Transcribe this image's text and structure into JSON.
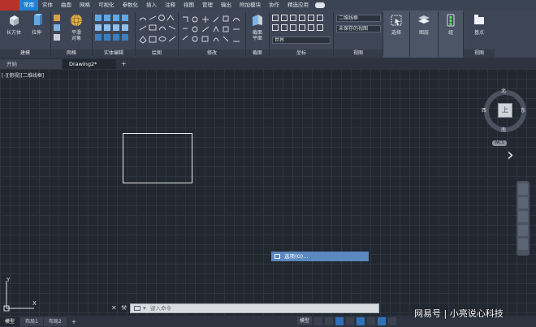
{
  "menu": {
    "items": [
      "常用",
      "实体",
      "曲面",
      "网格",
      "可视化",
      "参数化",
      "插入",
      "注释",
      "视图",
      "管理",
      "输出",
      "附加模块",
      "协作",
      "精选应用"
    ],
    "active_index": 0
  },
  "ribbon": {
    "tools": {
      "box": "长方体",
      "extrude": "拉伸",
      "smooth_object": "平滑\n对象",
      "section_plane": "截面\n平面",
      "selection": "选择",
      "layers": "图层",
      "groups": "组",
      "base_point": "基点"
    },
    "panels": {
      "modeling": "建模",
      "mesh": "网格",
      "solid_editing": "实体编辑",
      "draw": "绘图",
      "modify": "修改",
      "section": "截面",
      "coordinates": "坐标",
      "view": "视图"
    },
    "dropdowns": {
      "visual_style": "二维线框",
      "view_state": "未保存的视图",
      "ucs": "世界"
    }
  },
  "tabs": {
    "start": "开始",
    "drawing": "Drawing2*",
    "add": "+"
  },
  "viewport": {
    "label": "[-][俯视][二维线框]"
  },
  "viewcube": {
    "top_face": "上",
    "north": "北",
    "south": "南",
    "east": "东",
    "west": "西",
    "wcs": "WCS"
  },
  "context_menu": {
    "item": "选项(O)..."
  },
  "ucs_icon": {
    "x": "X",
    "y": "Y"
  },
  "command_line": {
    "placeholder": "键入命令"
  },
  "status": {
    "layouts": [
      "模型",
      "布局1",
      "布局2"
    ],
    "add_layout": "+",
    "model_button": "模型"
  },
  "watermark": {
    "text": "网易号 | 小亮说心科技"
  },
  "colors": {
    "canvas": "#212830",
    "ribbon": "#3e4656",
    "accent": "#1d82d4",
    "context_highlight": "#5b88bf"
  }
}
